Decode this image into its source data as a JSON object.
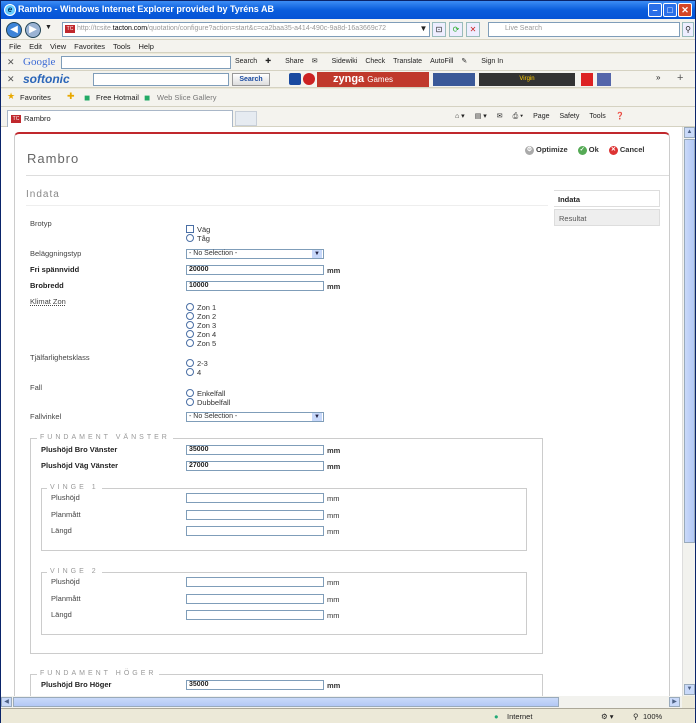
{
  "window": {
    "title": "Rambro - Windows Internet Explorer provided by Tyréns AB"
  },
  "nav": {
    "url_prefix": "http://tcsite.",
    "url_domain": "tacton.com",
    "url_rest": "/quotation/configure?action=start&c=ca2baa35-a414-490c-9a8d-16a3669c72",
    "search_placeholder": "Live Search"
  },
  "menu": [
    "File",
    "Edit",
    "View",
    "Favorites",
    "Tools",
    "Help"
  ],
  "toolbar1": {
    "brand": "Google",
    "items": [
      "Search",
      "Share",
      "Sidewiki",
      "Check",
      "Translate",
      "AutoFill",
      "Sign In"
    ]
  },
  "toolbar2": {
    "brand": "softonic",
    "search_btn": "Search",
    "zynga": "zynga",
    "zynga_sub": "Games",
    "virgin": "Virgin"
  },
  "favorites": {
    "label": "Favorites",
    "items": [
      "Free Hotmail",
      "Web Slice Gallery"
    ]
  },
  "tab": {
    "title": "Rambro",
    "favicon": "TC"
  },
  "commands": [
    "Page",
    "Safety",
    "Tools"
  ],
  "app": {
    "title": "Rambro",
    "section": "Indata",
    "actions": {
      "optimize": "Optimize",
      "ok": "Ok",
      "cancel": "Cancel"
    },
    "side_tabs": [
      "Indata",
      "Resultat"
    ]
  },
  "form": {
    "brotyp": {
      "label": "Brotyp",
      "options": [
        "Väg",
        "Tåg"
      ]
    },
    "belagg": {
      "label": "Beläggningstyp",
      "value": "- No Selection -"
    },
    "spann": {
      "label": "Fri spännvidd",
      "value": "20000",
      "unit": "mm"
    },
    "bredd": {
      "label": "Brobredd",
      "value": "10000",
      "unit": "mm"
    },
    "klimat": {
      "label": "Klimat Zon",
      "options": [
        "Zon 1",
        "Zon 2",
        "Zon 3",
        "Zon 4",
        "Zon 5"
      ]
    },
    "tjal": {
      "label": "Tjälfarlighetsklass",
      "options": [
        "2-3",
        "4"
      ]
    },
    "fall": {
      "label": "Fall",
      "options": [
        "Enkelfall",
        "Dubbelfall"
      ]
    },
    "fallvinkel": {
      "label": "Fallvinkel",
      "value": "- No Selection -"
    },
    "fv": {
      "legend": "FUNDAMENT VÄNSTER",
      "bro_label": "Plushöjd Bro Vänster",
      "bro_value": "35000",
      "vag_label": "Plushöjd Väg Vänster",
      "vag_value": "27000",
      "unit": "mm"
    },
    "vinge1": {
      "legend": "VINGE 1",
      "fields": [
        "Plushöjd",
        "Planmått",
        "Längd"
      ],
      "unit": "mm"
    },
    "vinge2": {
      "legend": "VINGE 2",
      "fields": [
        "Plushöjd",
        "Planmått",
        "Längd"
      ],
      "unit": "mm"
    },
    "fh": {
      "legend": "FUNDAMENT HÖGER",
      "bro_label": "Plushöjd Bro Höger",
      "bro_value": "35000",
      "unit": "mm"
    }
  },
  "status": {
    "zone": "Internet",
    "zoom": "100%"
  }
}
